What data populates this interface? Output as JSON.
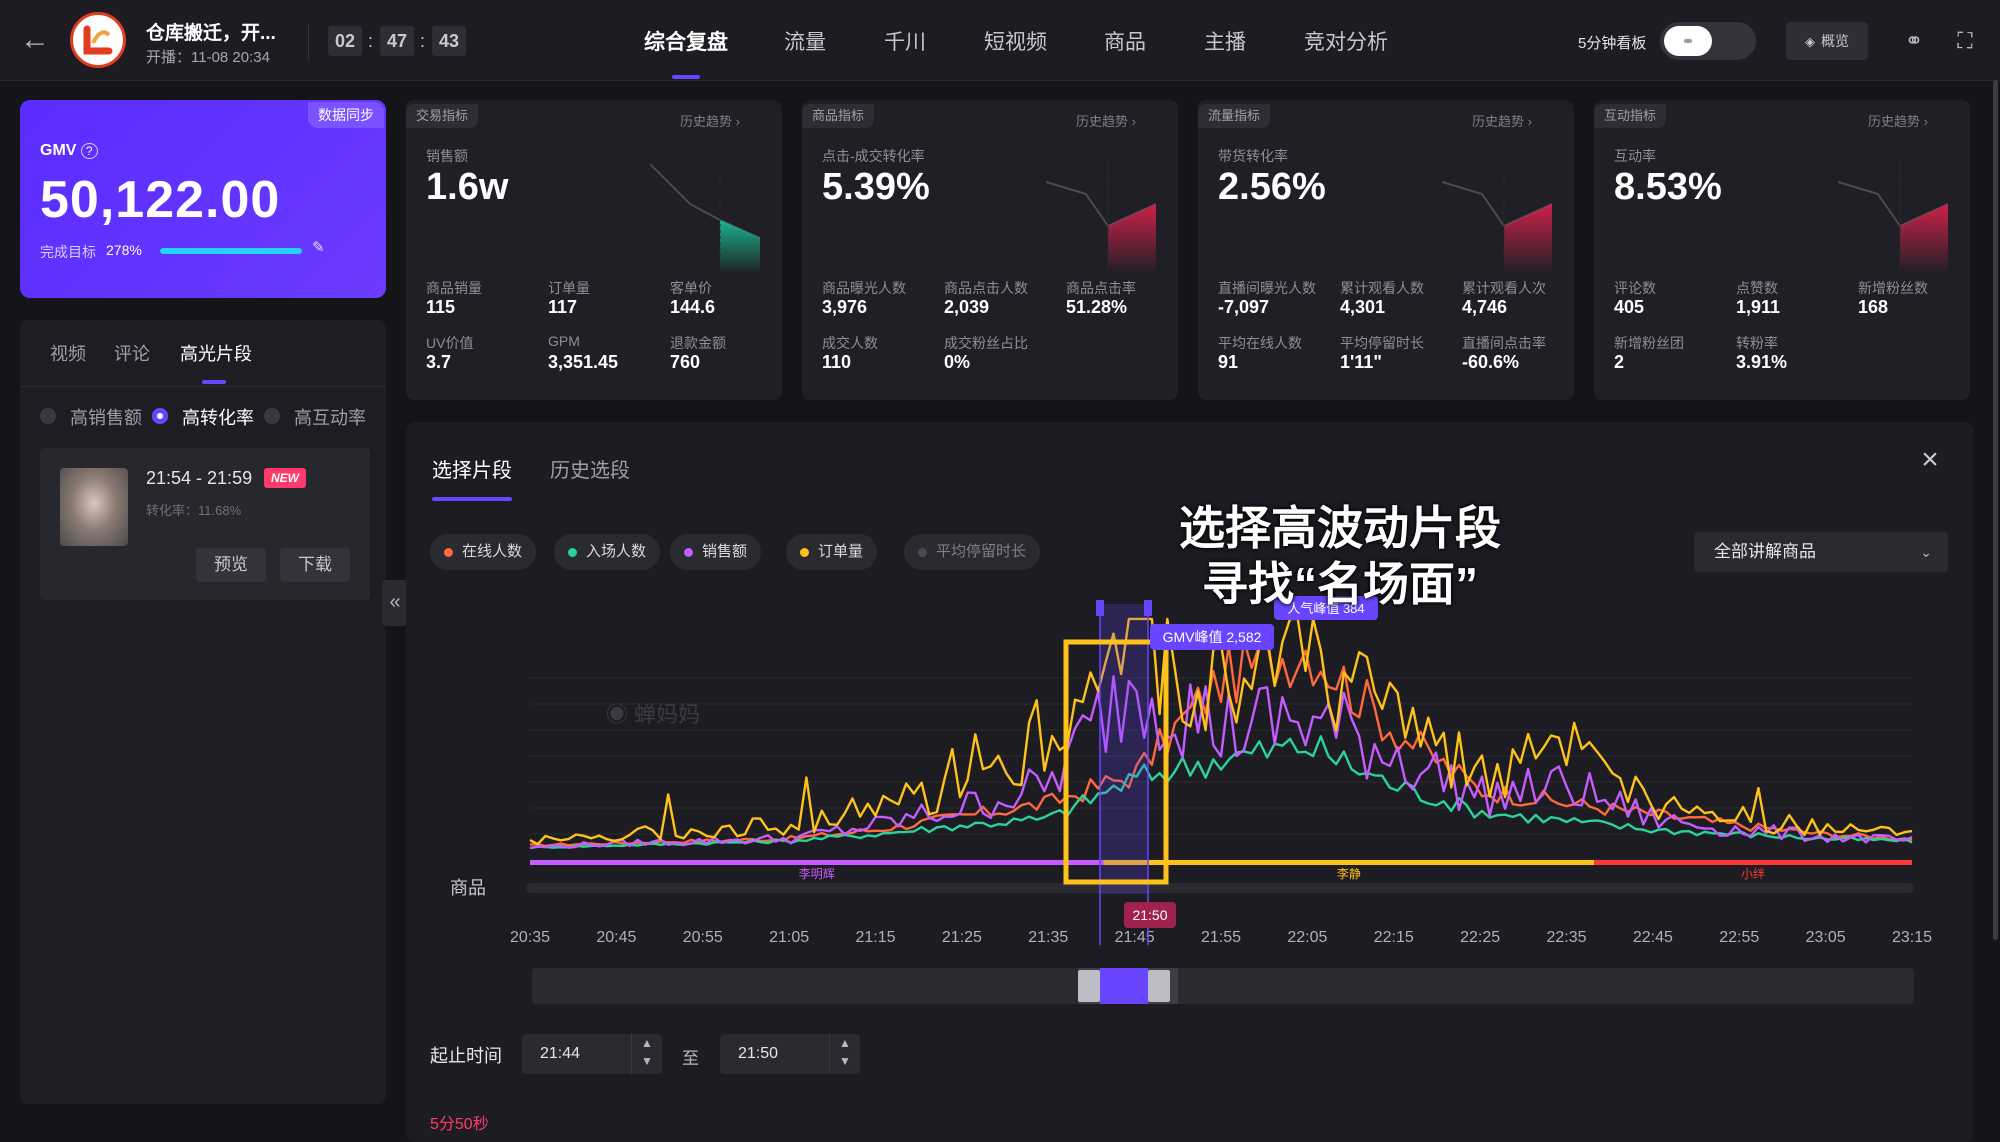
{
  "header": {
    "room_title": "仓库搬迁，开...",
    "room_start": "开播：11-08 20:34",
    "timer": [
      "02",
      "47",
      "43"
    ],
    "nav_tabs": [
      "综合复盘",
      "流量",
      "千川",
      "短视频",
      "商品",
      "主播",
      "竞对分析"
    ],
    "active_tab": "综合复盘",
    "board_label": "5分钟看板",
    "overview_label": "概览"
  },
  "gmv": {
    "sync_tag": "数据同步",
    "label": "GMV",
    "value": "50,122.00",
    "target_label": "完成目标",
    "target_pct": "278%"
  },
  "left_panel": {
    "tabs": [
      "视频",
      "评论",
      "高光片段"
    ],
    "active_tab": "高光片段",
    "filters": [
      "高销售额",
      "高转化率",
      "高互动率"
    ],
    "active_filter": "高转化率",
    "clip": {
      "time": "21:54 - 21:59",
      "badge": "NEW",
      "rate": "转化率：11.68%",
      "preview": "预览",
      "download": "下载"
    }
  },
  "metric_cards": [
    {
      "tag": "交易指标",
      "history": "历史趋势",
      "main_label": "销售额",
      "main_value": "1.6w",
      "trend": "down",
      "sub": [
        {
          "label": "商品销量",
          "value": "115"
        },
        {
          "label": "订单量",
          "value": "117"
        },
        {
          "label": "客单价",
          "value": "144.6"
        },
        {
          "label": "UV价值",
          "value": "3.7"
        },
        {
          "label": "GPM",
          "value": "3,351.45"
        },
        {
          "label": "退款金额",
          "value": "760"
        }
      ]
    },
    {
      "tag": "商品指标",
      "history": "历史趋势",
      "main_label": "点击-成交转化率",
      "main_value": "5.39%",
      "trend": "up",
      "sub": [
        {
          "label": "商品曝光人数",
          "value": "3,976"
        },
        {
          "label": "商品点击人数",
          "value": "2,039"
        },
        {
          "label": "商品点击率",
          "value": "51.28%"
        },
        {
          "label": "成交人数",
          "value": "110"
        },
        {
          "label": "成交粉丝占比",
          "value": "0%"
        }
      ]
    },
    {
      "tag": "流量指标",
      "history": "历史趋势",
      "main_label": "带货转化率",
      "main_value": "2.56%",
      "trend": "up",
      "sub": [
        {
          "label": "直播间曝光人数",
          "value": "-7,097"
        },
        {
          "label": "累计观看人数",
          "value": "4,301"
        },
        {
          "label": "累计观看人次",
          "value": "4,746"
        },
        {
          "label": "平均在线人数",
          "value": "91"
        },
        {
          "label": "平均停留时长",
          "value": "1'11\""
        },
        {
          "label": "直播间点击率",
          "value": "-60.6%"
        }
      ]
    },
    {
      "tag": "互动指标",
      "history": "历史趋势",
      "main_label": "互动率",
      "main_value": "8.53%",
      "trend": "up",
      "sub": [
        {
          "label": "评论数",
          "value": "405"
        },
        {
          "label": "点赞数",
          "value": "1,911"
        },
        {
          "label": "新增粉丝数",
          "value": "168"
        },
        {
          "label": "新增粉丝团",
          "value": "2"
        },
        {
          "label": "转粉率",
          "value": "3.91%"
        }
      ]
    }
  ],
  "bottom_panel": {
    "tabs": [
      "选择片段",
      "历史选段"
    ],
    "active_tab": "选择片段",
    "legend": [
      {
        "label": "在线人数",
        "color": "#ff6a3d",
        "on": true
      },
      {
        "label": "入场人数",
        "color": "#2bd39b",
        "on": true
      },
      {
        "label": "销售额",
        "color": "#c45cff",
        "on": true
      },
      {
        "label": "订单量",
        "color": "#ffc21a",
        "on": true
      },
      {
        "label": "平均停留时长",
        "color": "#4a4a52",
        "on": false
      }
    ],
    "product_select": "全部讲解商品",
    "overlay_text": [
      "选择高波动片段",
      "寻找“名场面”"
    ],
    "watermark": "蝉妈妈",
    "time_range_label": "起止时间",
    "start_time": "21:44",
    "end_time": "21:50",
    "to_label": "至",
    "bottom_cut_text": "5分50秒"
  },
  "chart_data": {
    "type": "line",
    "x": [
      "20:35",
      "20:45",
      "20:55",
      "21:05",
      "21:15",
      "21:25",
      "21:35",
      "21:45",
      "21:55",
      "22:05",
      "22:15",
      "22:25",
      "22:35",
      "22:45",
      "22:55",
      "23:05",
      "23:15"
    ],
    "x_tick_labels": [
      "20:35",
      "20:45",
      "20:55",
      "21:05",
      "21:15",
      "21:25",
      "21:35",
      "21:45",
      "21:55",
      "22:05",
      "22:15",
      "22:25",
      "22:35",
      "22:45",
      "22:55",
      "23:05",
      "23:15"
    ],
    "series": [
      {
        "name": "在线人数",
        "color": "#ff6a3d",
        "values": [
          0.03,
          0.04,
          0.05,
          0.06,
          0.1,
          0.16,
          0.22,
          0.35,
          0.78,
          0.93,
          0.55,
          0.28,
          0.22,
          0.17,
          0.12,
          0.08,
          0.06
        ]
      },
      {
        "name": "入场人数",
        "color": "#2bd39b",
        "values": [
          0.02,
          0.03,
          0.04,
          0.05,
          0.08,
          0.12,
          0.15,
          0.33,
          0.42,
          0.48,
          0.3,
          0.18,
          0.14,
          0.1,
          0.08,
          0.06,
          0.05
        ]
      },
      {
        "name": "销售额",
        "color": "#c45cff",
        "values": [
          0.02,
          0.04,
          0.05,
          0.06,
          0.12,
          0.2,
          0.3,
          0.8,
          0.55,
          0.6,
          0.45,
          0.25,
          0.3,
          0.15,
          0.1,
          0.07,
          0.05
        ]
      },
      {
        "name": "订单量",
        "color": "#ffc21a",
        "values": [
          0.05,
          0.08,
          0.1,
          0.12,
          0.2,
          0.3,
          0.5,
          1.0,
          0.75,
          0.85,
          0.6,
          0.35,
          0.45,
          0.2,
          0.15,
          0.1,
          0.08
        ]
      }
    ],
    "annotations": [
      "GMV峰值 2,582",
      "人气峰值 384"
    ],
    "selected_window": [
      "21:44",
      "21:50"
    ],
    "cursor_label": "21:50",
    "product_row_label": "商品",
    "anchors": [
      {
        "label": "李明辉",
        "color": "#c45cff"
      },
      {
        "label": "李静",
        "color": "#ffc21a"
      },
      {
        "label": "小绊",
        "color": "#ff3a3a"
      }
    ]
  }
}
